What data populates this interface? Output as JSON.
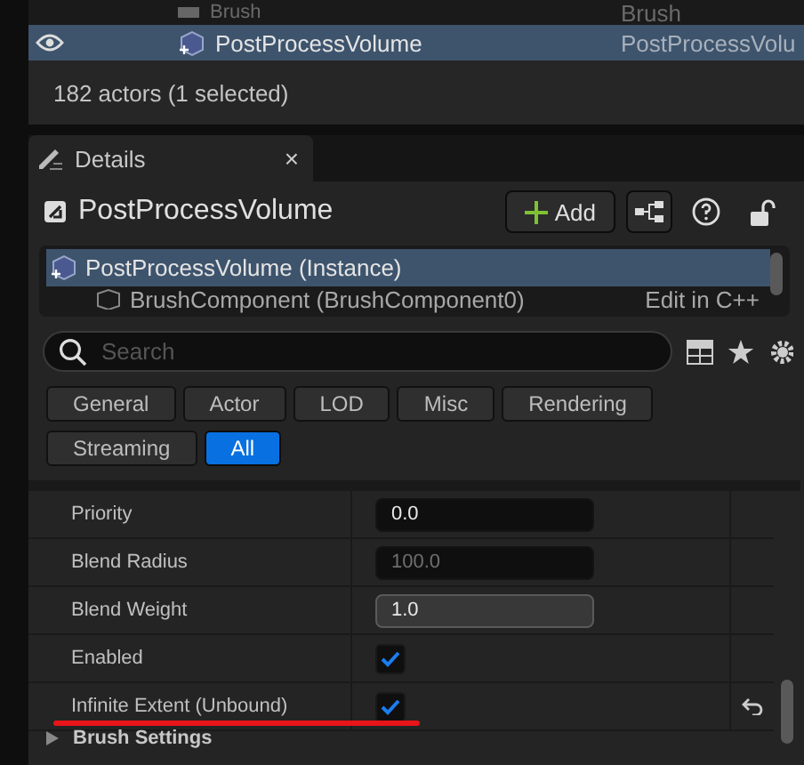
{
  "outliner": {
    "rows": [
      {
        "name": "Brush",
        "type": "Brush",
        "selected": false,
        "visible": false
      },
      {
        "name": "PostProcessVolume",
        "type": "PostProcessVolu",
        "selected": true,
        "visible": true
      }
    ],
    "status": "182 actors (1 selected)"
  },
  "details_tab": {
    "title": "Details",
    "close": "×"
  },
  "header": {
    "title": "PostProcessVolume",
    "add_button": "Add"
  },
  "components": [
    {
      "name": "PostProcessVolume (Instance)",
      "selected": true
    },
    {
      "name": "BrushComponent (BrushComponent0)",
      "action": "Edit in C++",
      "selected": false
    }
  ],
  "search": {
    "placeholder": "Search"
  },
  "filters": [
    {
      "label": "General",
      "selected": false
    },
    {
      "label": "Actor",
      "selected": false
    },
    {
      "label": "LOD",
      "selected": false
    },
    {
      "label": "Misc",
      "selected": false
    },
    {
      "label": "Rendering",
      "selected": false
    },
    {
      "label": "Streaming",
      "selected": false
    },
    {
      "label": "All",
      "selected": true
    }
  ],
  "properties": [
    {
      "label": "Priority",
      "kind": "number",
      "value": "0.0",
      "disabled": false,
      "focused": false,
      "reset": false
    },
    {
      "label": "Blend Radius",
      "kind": "number",
      "value": "100.0",
      "disabled": true,
      "focused": false,
      "reset": false
    },
    {
      "label": "Blend Weight",
      "kind": "number",
      "value": "1.0",
      "disabled": false,
      "focused": true,
      "reset": false
    },
    {
      "label": "Enabled",
      "kind": "checkbox",
      "checked": true,
      "reset": false
    },
    {
      "label": "Infinite Extent (Unbound)",
      "kind": "checkbox",
      "checked": true,
      "reset": true
    }
  ],
  "next_section": "Brush Settings"
}
